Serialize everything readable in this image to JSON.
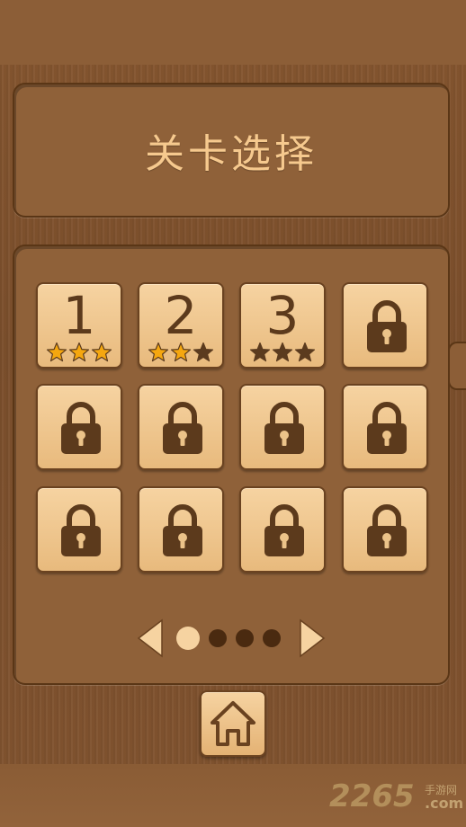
{
  "title": "关卡选择",
  "levels": [
    {
      "label": "1",
      "locked": false,
      "stars": 3
    },
    {
      "label": "2",
      "locked": false,
      "stars": 2
    },
    {
      "label": "3",
      "locked": false,
      "stars": 0
    },
    {
      "label": "",
      "locked": true
    },
    {
      "label": "",
      "locked": true
    },
    {
      "label": "",
      "locked": true
    },
    {
      "label": "",
      "locked": true
    },
    {
      "label": "",
      "locked": true
    },
    {
      "label": "",
      "locked": true
    },
    {
      "label": "",
      "locked": true
    },
    {
      "label": "",
      "locked": true
    },
    {
      "label": "",
      "locked": true
    }
  ],
  "max_stars": 3,
  "pager": {
    "pages": 4,
    "current": 1
  },
  "home": {
    "icon": "home-icon"
  },
  "watermark": {
    "number": "2265",
    "site": "手游网",
    "domain": ".com"
  },
  "colors": {
    "star_filled": "#f5a70f",
    "star_empty": "#5b3b1e",
    "tile": "#f0c88f",
    "lock": "#5c3a1c",
    "title_text": "#f6c98e"
  }
}
